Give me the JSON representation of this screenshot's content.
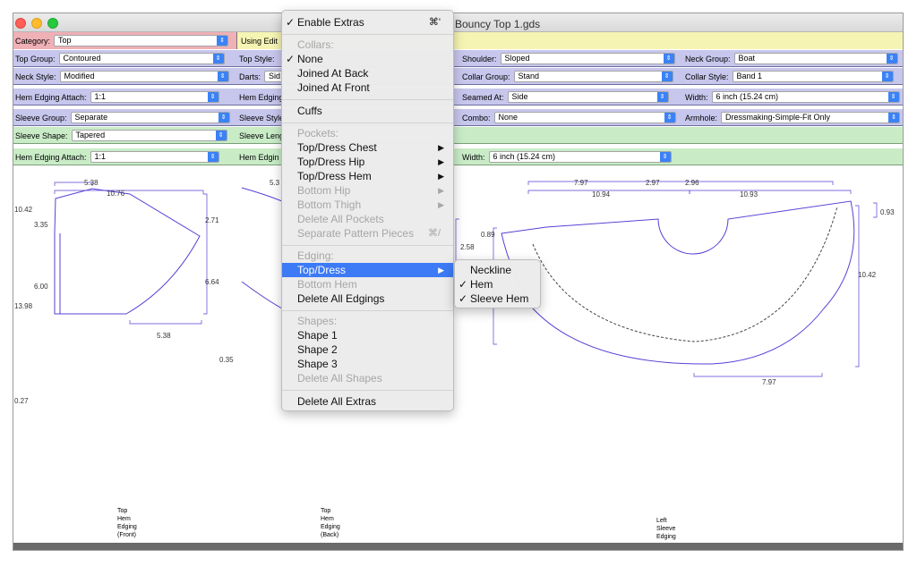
{
  "window": {
    "title": "Bouncy Top 1.gds"
  },
  "rows": {
    "category": {
      "label": "Category:",
      "value": "Top"
    },
    "using_edit": {
      "label": "Using Edit"
    },
    "top_group": {
      "label": "Top Group:",
      "value": "Contoured"
    },
    "top_style": {
      "label": "Top Style:"
    },
    "shoulder": {
      "label": "Shoulder:",
      "value": "Sloped"
    },
    "neck_group": {
      "label": "Neck Group:",
      "value": "Boat"
    },
    "neck_style": {
      "label": "Neck Style:",
      "value": "Modified"
    },
    "darts": {
      "label": "Darts:",
      "value": "Sid"
    },
    "collar_group": {
      "label": "Collar Group:",
      "value": "Stand"
    },
    "collar_style": {
      "label": "Collar Style:",
      "value": "Band 1"
    },
    "hem_edging_attach": {
      "label": "Hem Edging Attach:",
      "value": "1:1"
    },
    "hem_edging": {
      "label": "Hem Edging"
    },
    "seamed_at": {
      "label": "Seamed At:",
      "value": "Side"
    },
    "width": {
      "label": "Width:",
      "value": "6 inch (15.24 cm)"
    },
    "sleeve_group": {
      "label": "Sleeve Group:",
      "value": "Separate"
    },
    "sleeve_style": {
      "label": "Sleeve Style"
    },
    "combo": {
      "label": "Combo:",
      "value": "None"
    },
    "armhole": {
      "label": "Armhole:",
      "value": "Dressmaking-Simple-Fit Only"
    },
    "sleeve_shape": {
      "label": "Sleeve Shape:",
      "value": "Tapered"
    },
    "sleeve_length": {
      "label": "Sleeve Leng"
    },
    "sleeve_hem_attach": {
      "label": "Hem Edging Attach:",
      "value": "1:1"
    },
    "sleeve_hem_edging": {
      "label": "Hem Edgin"
    },
    "sleeve_width": {
      "label": "Width:",
      "value": "6 inch (15.24 cm)"
    }
  },
  "menu": {
    "enable_extras": "Enable Extras",
    "enable_extras_shortcut": "⌘'",
    "collars_header": "Collars:",
    "none": "None",
    "joined_back": "Joined At Back",
    "joined_front": "Joined At Front",
    "cuffs": "Cuffs",
    "pockets_header": "Pockets:",
    "top_chest": "Top/Dress Chest",
    "top_hip": "Top/Dress Hip",
    "top_hem": "Top/Dress Hem",
    "bottom_hip": "Bottom Hip",
    "bottom_thigh": "Bottom Thigh",
    "delete_pockets": "Delete All Pockets",
    "separate_pieces": "Separate Pattern Pieces",
    "separate_shortcut": "⌘/",
    "edging_header": "Edging:",
    "edging_top": "Top/Dress",
    "edging_bottom_hem": "Bottom Hem",
    "delete_edgings": "Delete All Edgings",
    "shapes_header": "Shapes:",
    "shape1": "Shape 1",
    "shape2": "Shape 2",
    "shape3": "Shape 3",
    "delete_shapes": "Delete All Shapes",
    "delete_extras": "Delete All Extras",
    "check": "✓",
    "arrow": "▶"
  },
  "submenu": {
    "neckline": "Neckline",
    "hem": "Hem",
    "sleeve_hem": "Sleeve Hem"
  },
  "dims": {
    "p1_top_a": "5.38",
    "p1_top_b": "10.76",
    "p1_left_a": "10.42",
    "p1_left_b": "3.35",
    "p1_left_c": "6.00",
    "p1_left_d": "13.98",
    "p1_right_a": "2.71",
    "p1_right_b": "6.64",
    "p1_bottom": "5.38",
    "p1_low": "0.27",
    "p2_top": "5.3",
    "p2_side": "0.35",
    "p3_top_a": "7.97",
    "p3_top_b": "2.97",
    "p3_top_c": "2.96",
    "p3_top_d": "10.94",
    "p3_top_e": "10.93",
    "p3_left_a": "0.89",
    "p3_left_b": "2.58",
    "p3_right_a": "0.93",
    "p3_right_b": "10.42",
    "p3_bottom": "7.97"
  },
  "captions": {
    "front": [
      "Top",
      "Hem",
      "Edging",
      "(Front)"
    ],
    "back": [
      "Top",
      "Hem",
      "Edging",
      "(Back)"
    ],
    "sleeve": [
      "Left",
      "Sleeve",
      "Edging"
    ]
  }
}
